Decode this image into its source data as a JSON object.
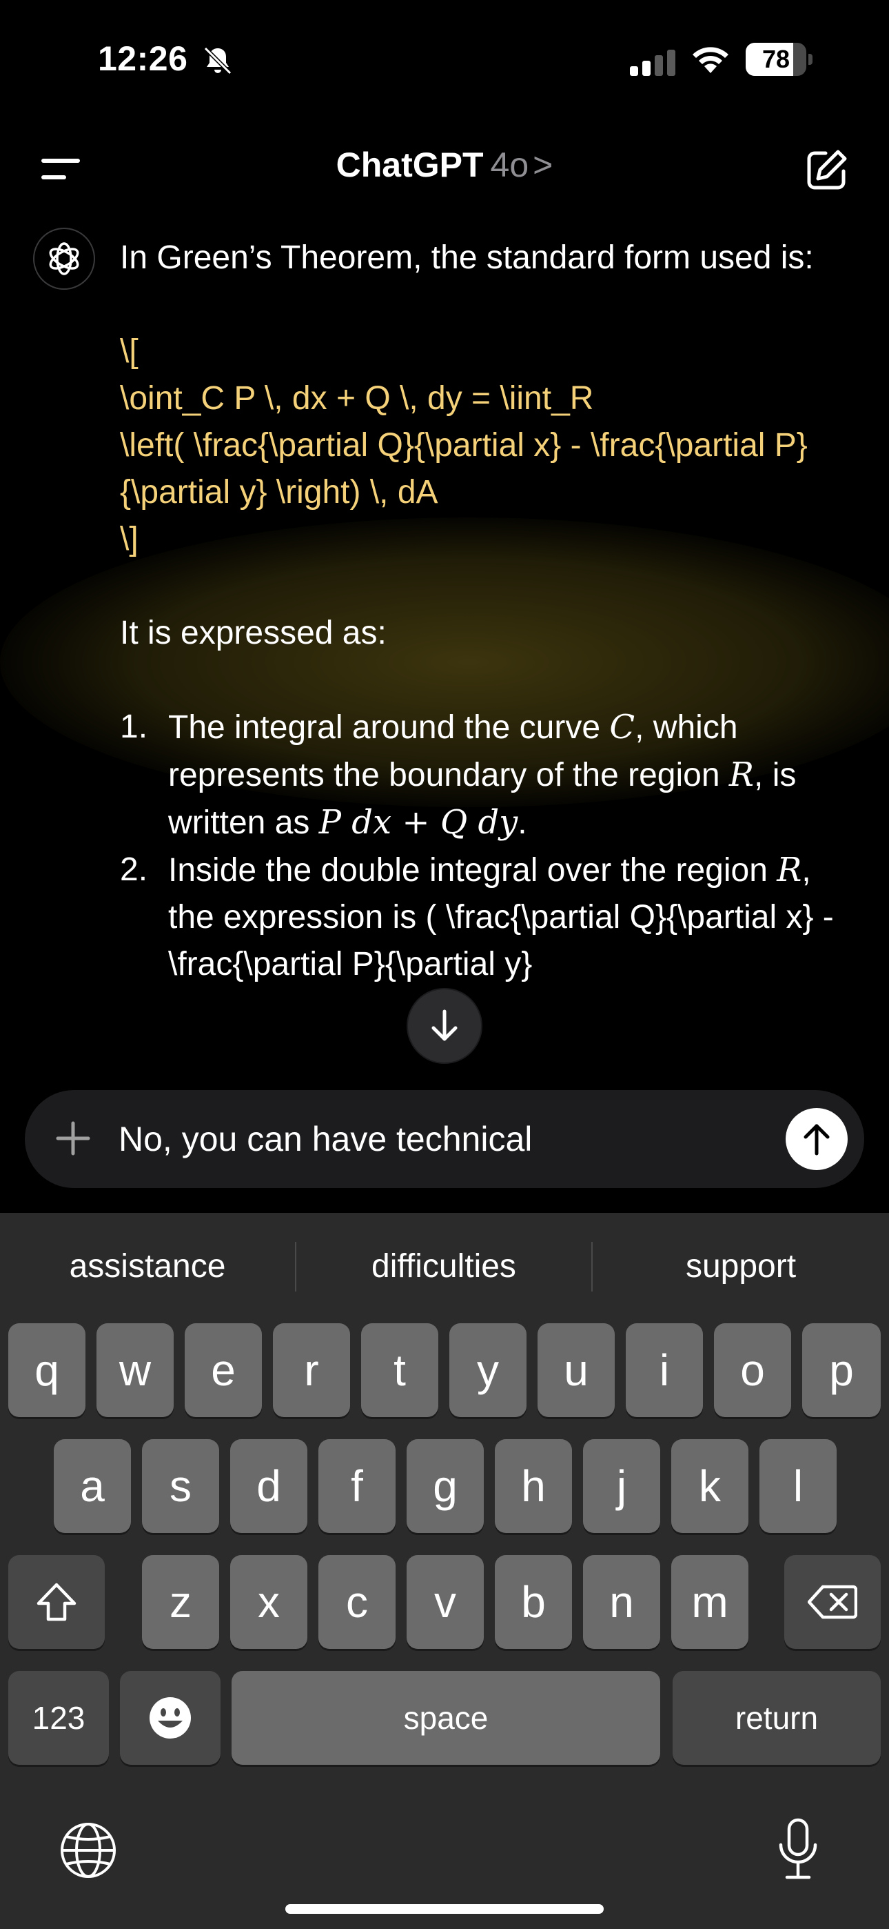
{
  "status_bar": {
    "time": "12:26",
    "battery_level": "78",
    "battery_fraction": 0.78
  },
  "header": {
    "title": "ChatGPT",
    "model": "4o",
    "chevron": ">"
  },
  "message": {
    "intro": "In Green’s Theorem, the standard form used is:",
    "latex_lines": [
      "\\[",
      "\\oint_C P \\, dx + Q \\, dy = \\iint_R",
      "\\left( \\frac{\\partial Q}{\\partial x} - \\frac{\\partial P}{\\partial y} \\right) \\, dA",
      "\\]"
    ],
    "expressed": "It is expressed as:",
    "steps": [
      {
        "num": "1.",
        "text_a": "The integral around the curve ",
        "math_a": "C",
        "text_b": ", which represents the boundary of the region ",
        "math_b": "R",
        "text_c": ", is written as ",
        "math_c": "P dx + Q dy",
        "text_d": "."
      },
      {
        "num": "2.",
        "text_a": "Inside the double integral over the region ",
        "math_a": "R",
        "text_b": ", the expression is ( \\frac{\\partial Q}{\\partial x} - \\frac{\\partial P}{\\partial y}"
      }
    ]
  },
  "composer": {
    "plus": "+",
    "text": "No, you can have technical"
  },
  "keyboard": {
    "suggestions": [
      "assistance",
      "difficulties",
      "support"
    ],
    "row1": [
      "q",
      "w",
      "e",
      "r",
      "t",
      "y",
      "u",
      "i",
      "o",
      "p"
    ],
    "row2": [
      "a",
      "s",
      "d",
      "f",
      "g",
      "h",
      "j",
      "k",
      "l"
    ],
    "row3": [
      "z",
      "x",
      "c",
      "v",
      "b",
      "n",
      "m"
    ],
    "numbers_label": "123",
    "space_label": "space",
    "return_label": "return"
  },
  "icons": {
    "menu": "menu-icon",
    "compose": "compose-icon",
    "avatar": "openai-logo-icon",
    "scroll": "arrow-down-icon",
    "send": "arrow-up-icon",
    "shift": "shift-icon",
    "delete": "backspace-icon",
    "emoji": "emoji-icon",
    "globe": "globe-icon",
    "mic": "microphone-icon"
  },
  "colors": {
    "latex_text": "#f5d27a",
    "background": "#000000",
    "key": "#6b6b6b",
    "key_dark": "#474747"
  }
}
